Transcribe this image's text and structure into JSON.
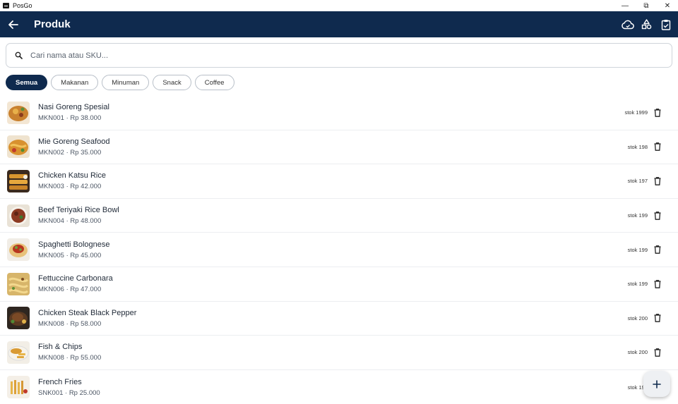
{
  "window": {
    "app_name": "PosGo",
    "controls": {
      "minimize": "—",
      "restore": "⧉",
      "close": "✕"
    }
  },
  "appbar": {
    "title": "Produk",
    "icons": [
      "back-arrow-icon",
      "cloud-sync-icon",
      "category-icon",
      "clipboard-check-icon"
    ]
  },
  "search": {
    "placeholder": "Cari nama atau SKU...",
    "value": ""
  },
  "filters": [
    {
      "label": "Semua",
      "active": true
    },
    {
      "label": "Makanan",
      "active": false
    },
    {
      "label": "Minuman",
      "active": false
    },
    {
      "label": "Snack",
      "active": false
    },
    {
      "label": "Coffee",
      "active": false
    }
  ],
  "products": [
    {
      "name": "Nasi Goreng Spesial",
      "sub": "MKN001 · Rp 38.000",
      "stock": "stok 1999"
    },
    {
      "name": "Mie Goreng Seafood",
      "sub": "MKN002 · Rp 35.000",
      "stock": "stok 198"
    },
    {
      "name": "Chicken Katsu Rice",
      "sub": "MKN003 · Rp 42.000",
      "stock": "stok 197"
    },
    {
      "name": "Beef Teriyaki Rice Bowl",
      "sub": "MKN004 · Rp 48.000",
      "stock": "stok 199"
    },
    {
      "name": "Spaghetti Bolognese",
      "sub": "MKN005 · Rp 45.000",
      "stock": "stok 199"
    },
    {
      "name": "Fettuccine Carbonara",
      "sub": "MKN006 · Rp 47.000",
      "stock": "stok 199"
    },
    {
      "name": "Chicken Steak Black Pepper",
      "sub": "MKN008 · Rp 58.000",
      "stock": "stok 200"
    },
    {
      "name": "Fish & Chips",
      "sub": "MKN008 · Rp 55.000",
      "stock": "stok 200"
    },
    {
      "name": "French Fries",
      "sub": "SNK001 · Rp 25.000",
      "stock": "stok 199"
    }
  ],
  "fab": {
    "label": "+",
    "icon": "add-icon"
  },
  "colors": {
    "primary": "#0f2a4e",
    "chip_border": "#b8bfc8",
    "divider": "#eceef1"
  }
}
